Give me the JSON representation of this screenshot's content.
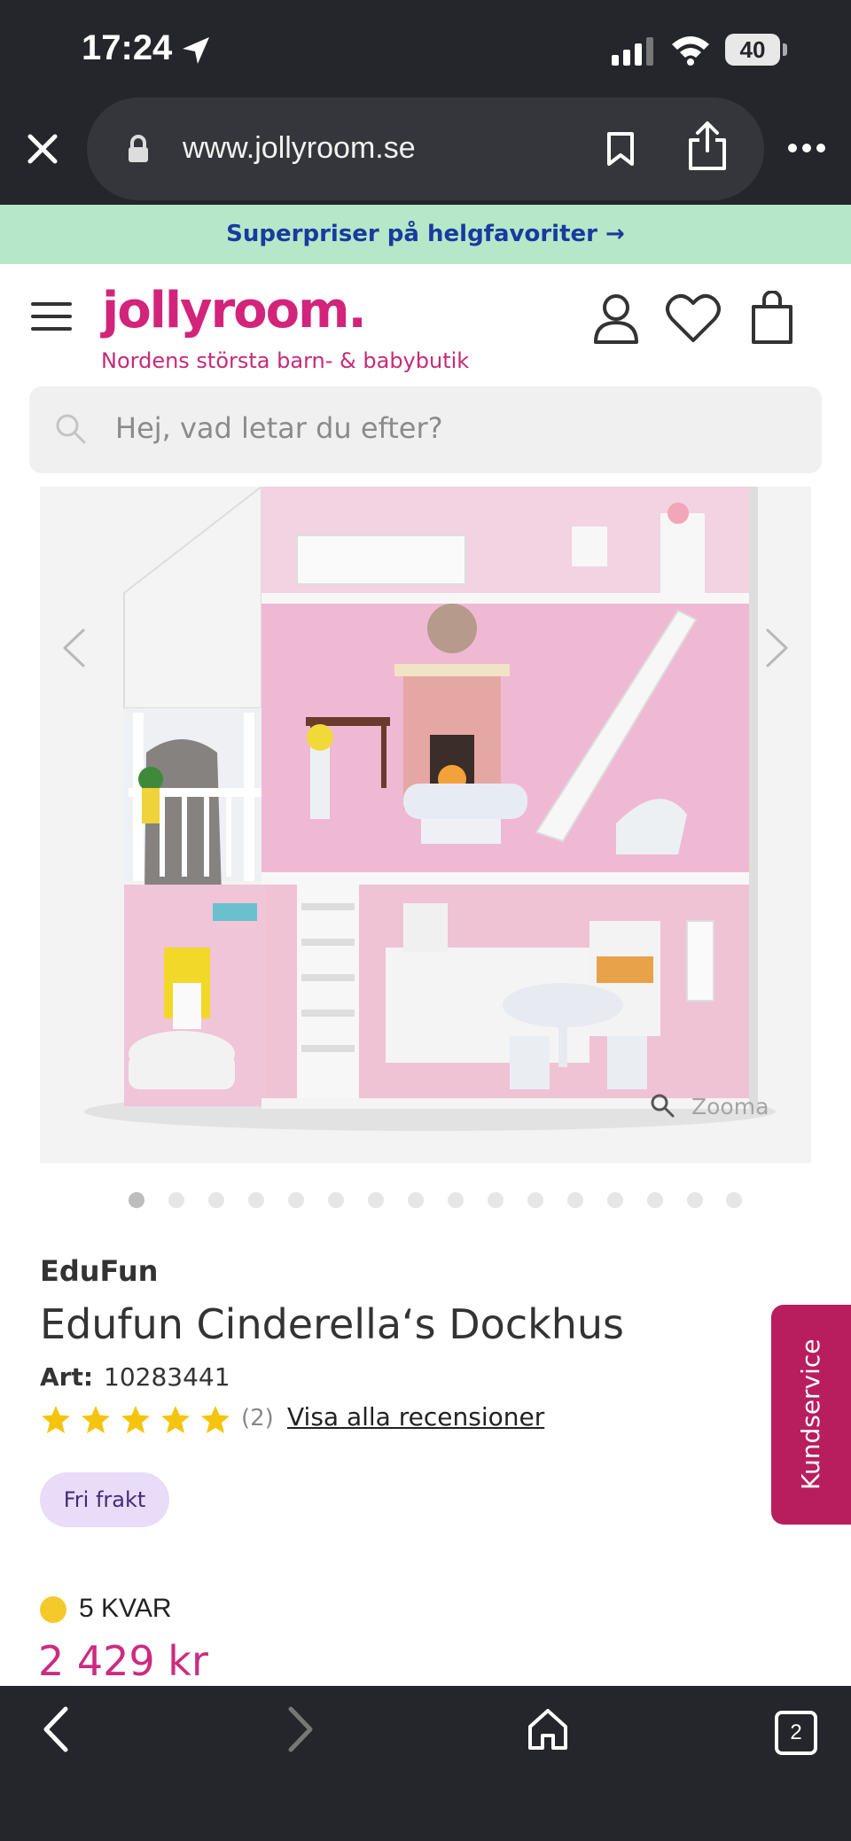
{
  "status_bar": {
    "time": "17:24",
    "battery": "40"
  },
  "browser": {
    "url": "www.jollyroom.se",
    "tab_count": "2"
  },
  "promo": {
    "text": "Superpriser på helgfavoriter →"
  },
  "header": {
    "logo": "jollyroom.",
    "tagline": "Nordens största barn- & babybutik",
    "search_placeholder": "Hej, vad letar du efter?"
  },
  "gallery": {
    "zoom_label": "Zooma",
    "image_count": 16,
    "active_index": 0
  },
  "product": {
    "brand": "EduFun",
    "title": "Edufun Cinderella‘s Dockhus",
    "art_label": "Art:",
    "art_number": "10283441",
    "rating": 5,
    "review_count": "(2)",
    "reviews_link": "Visa alla recensioner",
    "badge": "Fri frakt",
    "stock": "5 KVAR",
    "price": "2 429 kr"
  },
  "side_tab": {
    "label": "Kundservice"
  },
  "colors": {
    "brand_pink": "#d2247b",
    "promo_bg": "#b4e8c8",
    "promo_text": "#1a3a9e",
    "chrome_bg": "#25262b",
    "badge_bg": "#e9dcf8",
    "star": "#f5c40f",
    "stock": "#f6c92a",
    "kundservice": "#b81e5e"
  },
  "icons": [
    "location-arrow-icon",
    "signal-icon",
    "wifi-icon",
    "battery-icon",
    "close-icon",
    "lock-icon",
    "bookmark-icon",
    "share-icon",
    "more-icon",
    "hamburger-icon",
    "account-icon",
    "heart-icon",
    "bag-icon",
    "search-icon",
    "chevron-left-icon",
    "chevron-right-icon",
    "zoom-icon",
    "back-icon",
    "forward-icon",
    "home-icon",
    "tabs-icon"
  ]
}
